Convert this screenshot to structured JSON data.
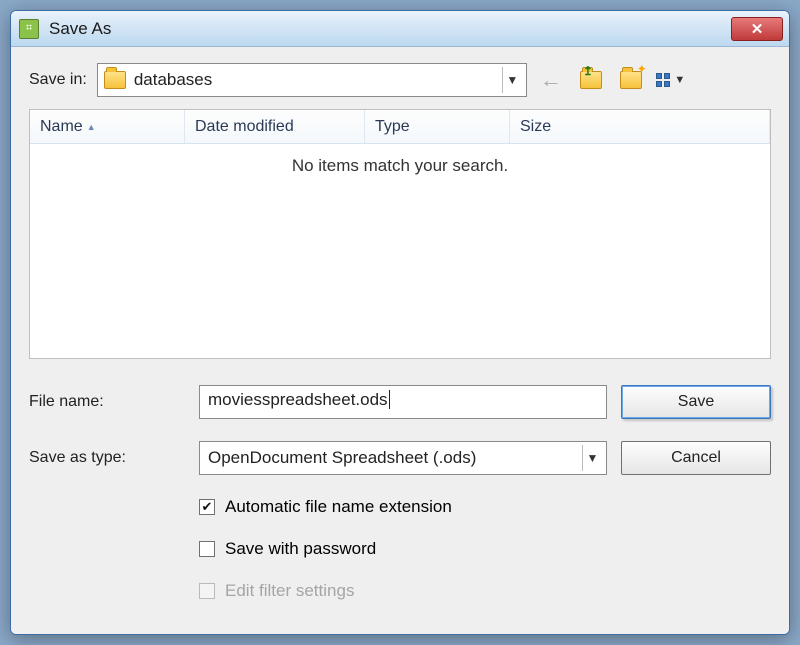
{
  "window": {
    "title": "Save As"
  },
  "toolbar": {
    "save_in_label": "Save in:",
    "current_folder": "databases"
  },
  "columns": {
    "name": "Name",
    "date": "Date modified",
    "type": "Type",
    "size": "Size"
  },
  "list": {
    "empty_message": "No items match your search."
  },
  "form": {
    "file_name_label": "File name:",
    "file_name_value": "moviesspreadsheet.ods",
    "type_label": "Save as type:",
    "type_value": "OpenDocument Spreadsheet (.ods)"
  },
  "buttons": {
    "save": "Save",
    "cancel": "Cancel"
  },
  "options": {
    "auto_ext": "Automatic file name extension",
    "save_pw": "Save with password",
    "filter": "Edit filter settings"
  }
}
